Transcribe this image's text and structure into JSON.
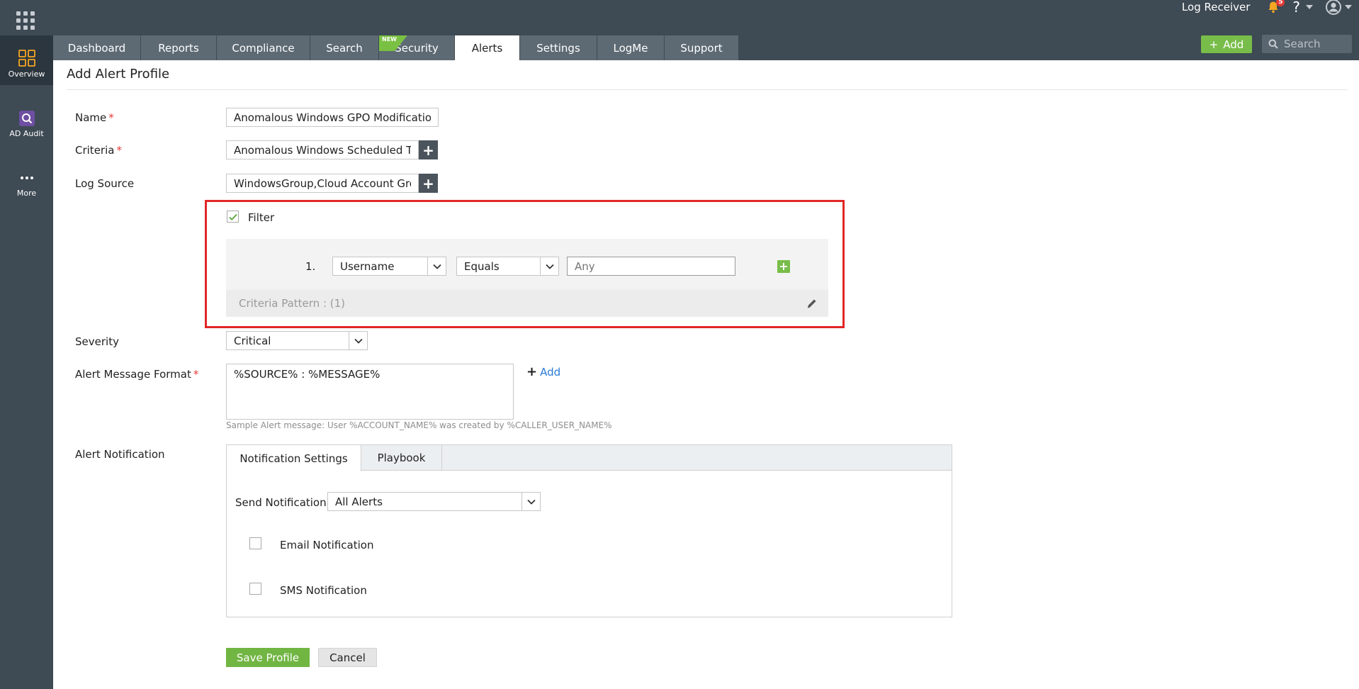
{
  "header": {
    "log_receiver": "Log Receiver",
    "notification_count": "5",
    "help_label": "?",
    "add_label": "Add",
    "search_placeholder": "Search",
    "new_tag": "NEW"
  },
  "nav": {
    "tabs": [
      {
        "label": "Dashboard"
      },
      {
        "label": "Reports"
      },
      {
        "label": "Compliance"
      },
      {
        "label": "Search"
      },
      {
        "label": "Security"
      },
      {
        "label": "Alerts"
      },
      {
        "label": "Settings"
      },
      {
        "label": "LogMe"
      },
      {
        "label": "Support"
      }
    ],
    "active": "Alerts"
  },
  "sidebar": {
    "items": [
      {
        "label": "Overview",
        "icon": "overview-grid-icon"
      },
      {
        "label": "AD Audit",
        "icon": "ad-audit-icon"
      },
      {
        "label": "More",
        "icon": "more-dots-icon"
      }
    ]
  },
  "page": {
    "title": "Add Alert Profile"
  },
  "form": {
    "name_label": "Name",
    "name_value": "Anomalous Windows GPO Modification",
    "criteria_label": "Criteria",
    "criteria_value": "Anomalous Windows Scheduled Task",
    "log_source_label": "Log Source",
    "log_source_value": "WindowsGroup,Cloud Account Group",
    "required_mark": "*",
    "filter": {
      "label": "Filter",
      "checked": true,
      "row_number": "1.",
      "field": "Username",
      "operator": "Equals",
      "value_placeholder": "Any",
      "criteria_pattern": "Criteria Pattern : (1)"
    },
    "severity_label": "Severity",
    "severity_value": "Critical",
    "message_format_label": "Alert Message Format",
    "message_format_value": "%SOURCE% : %MESSAGE%",
    "add_link": "Add",
    "sample_hint": "Sample Alert message: User %ACCOUNT_NAME% was created by %CALLER_USER_NAME%",
    "notification_label": "Alert Notification",
    "notification_tabs": [
      {
        "label": "Notification Settings"
      },
      {
        "label": "Playbook"
      }
    ],
    "send_notification_label": "Send Notification",
    "send_notification_value": "All Alerts",
    "email_notification_label": "Email Notification",
    "sms_notification_label": "SMS Notification",
    "save_label": "Save Profile",
    "cancel_label": "Cancel"
  },
  "colors": {
    "topbar": "#3e4a54",
    "accent_green": "#78bd4a",
    "highlight_red": "#e12727",
    "link_blue": "#2a7ad3"
  }
}
